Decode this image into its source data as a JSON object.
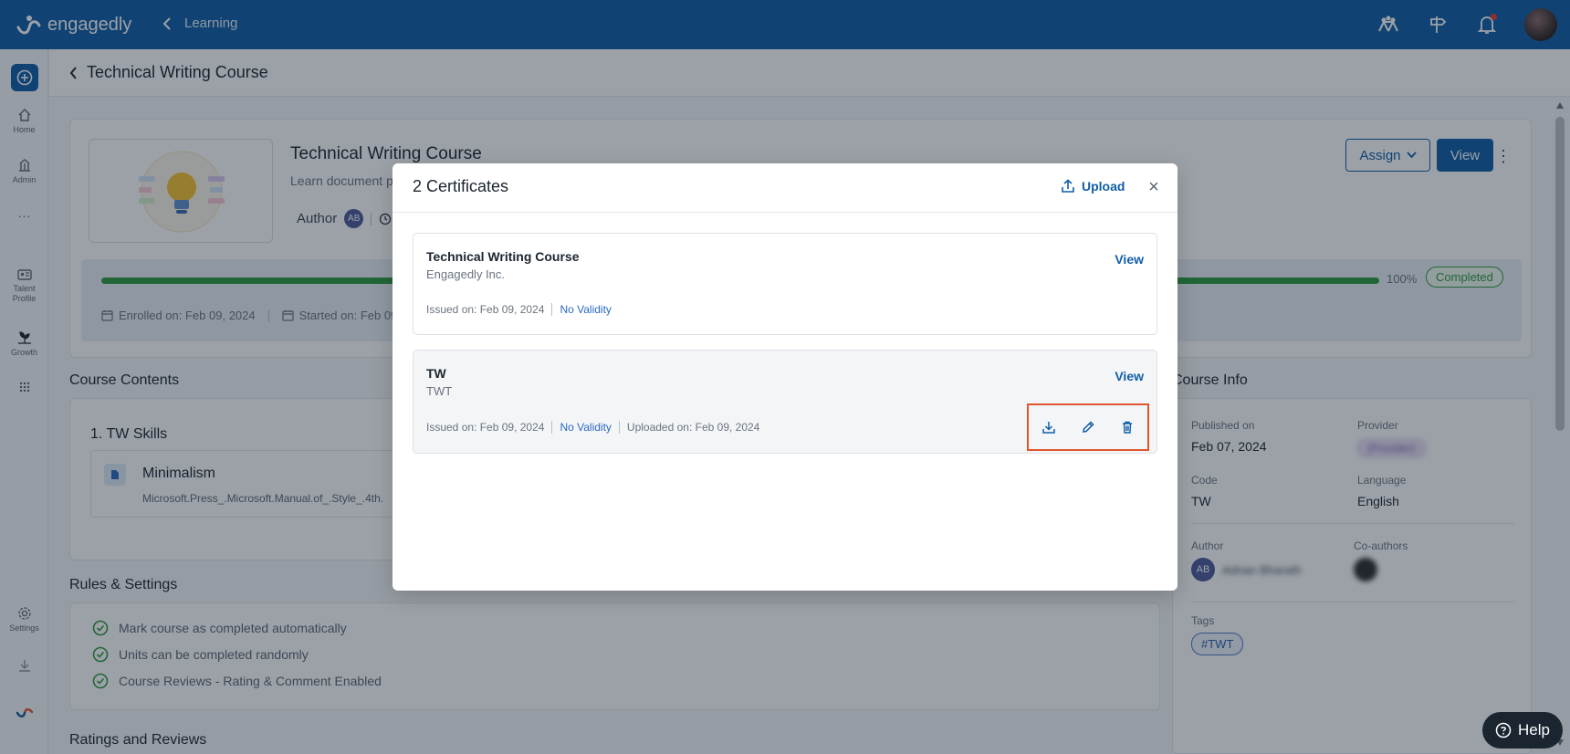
{
  "app": {
    "brand": "engagedly",
    "breadcrumb": "Learning"
  },
  "rail": {
    "items": [
      {
        "label": "Home"
      },
      {
        "label": "Admin"
      },
      {
        "label": "Talent Profile"
      },
      {
        "label": "Growth"
      },
      {
        "label": "Settings"
      }
    ]
  },
  "page": {
    "title": "Technical Writing Course"
  },
  "course": {
    "name": "Technical Writing Course",
    "description": "Learn document p",
    "author_label": "Author",
    "author_initials": "AB",
    "assign_label": "Assign",
    "view_label": "View",
    "progress": {
      "value": 100,
      "label": "100%",
      "status": "Completed"
    },
    "enrolled": "Enrolled on: Feb 09, 2024",
    "started": "Started on: Feb 09,"
  },
  "contents": {
    "title": "Course Contents",
    "unit": "1. TW Skills",
    "lesson": {
      "name": "Minimalism",
      "file": "Microsoft.Press_.Microsoft.Manual.of_.Style_.4th."
    }
  },
  "rules": {
    "title": "Rules & Settings",
    "items": [
      "Mark course as completed automatically",
      "Units can be completed randomly",
      "Course Reviews - Rating & Comment Enabled"
    ]
  },
  "ratings": {
    "title": "Ratings and Reviews"
  },
  "info": {
    "title": "Course Info",
    "published_label": "Published on",
    "published_value": "Feb 07, 2024",
    "provider_label": "Provider",
    "provider_value": "(Provider)",
    "code_label": "Code",
    "code_value": "TW",
    "language_label": "Language",
    "language_value": "English",
    "author_label": "Author",
    "author_initials": "AB",
    "author_name": "Adrian Bharath",
    "coauthors_label": "Co-authors",
    "tags_label": "Tags",
    "tag": "#TWT"
  },
  "modal": {
    "title": "2 Certificates",
    "upload_label": "Upload",
    "certificates": [
      {
        "name": "Technical Writing Course",
        "org": "Engagedly Inc.",
        "view_label": "View",
        "issued": "Issued on: Feb 09, 2024",
        "validity": "No Validity"
      },
      {
        "name": "TW",
        "org": "TWT",
        "view_label": "View",
        "issued": "Issued on: Feb 09, 2024",
        "validity": "No Validity",
        "uploaded": "Uploaded on: Feb 09, 2024"
      }
    ]
  },
  "help": {
    "label": "Help"
  },
  "colors": {
    "primary": "#0f5ea8",
    "success": "#2e9a3f",
    "highlight": "#e0552e"
  },
  "icons": [
    "search-icon",
    "bell-icon",
    "upload-icon",
    "download-icon",
    "edit-icon",
    "trash-icon",
    "close-icon",
    "calendar-icon",
    "check-circle-icon"
  ]
}
